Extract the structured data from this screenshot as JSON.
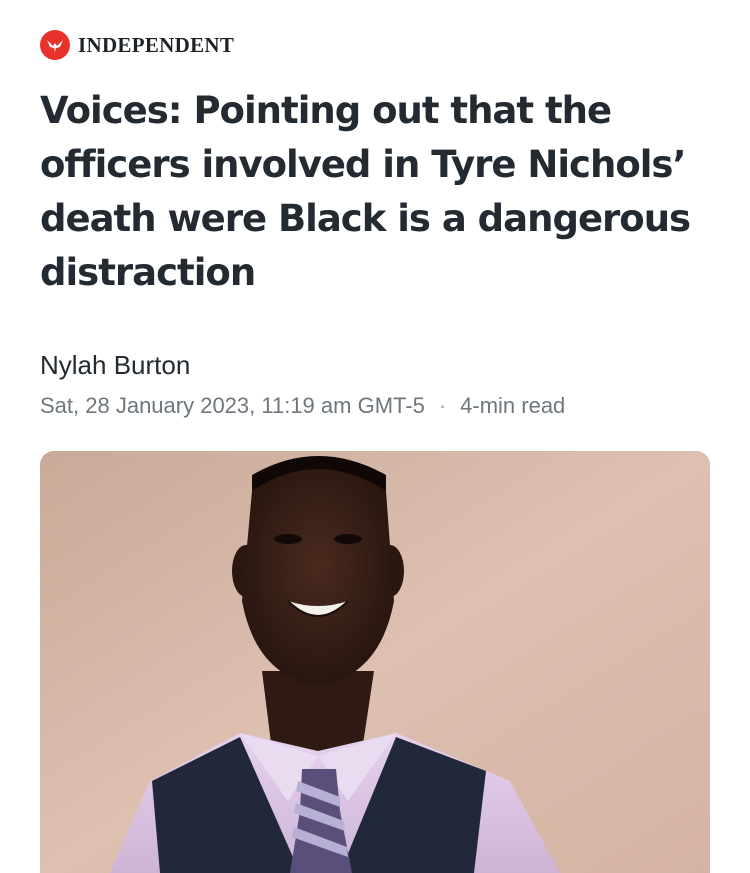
{
  "publisher": {
    "name": "INDEPENDENT",
    "logo_icon": "eagle-icon",
    "logo_color": "#e8322b"
  },
  "article": {
    "headline": "Voices: Pointing out that the officers involved in Tyre Nichols’ death were Black is a dangerous distraction",
    "author": "Nylah Burton",
    "date": "Sat, 28 January 2023, 11:19 am GMT-5",
    "read_time": "4-min read",
    "separator": "·"
  },
  "hero_image": {
    "subject": "photo-portrait"
  }
}
